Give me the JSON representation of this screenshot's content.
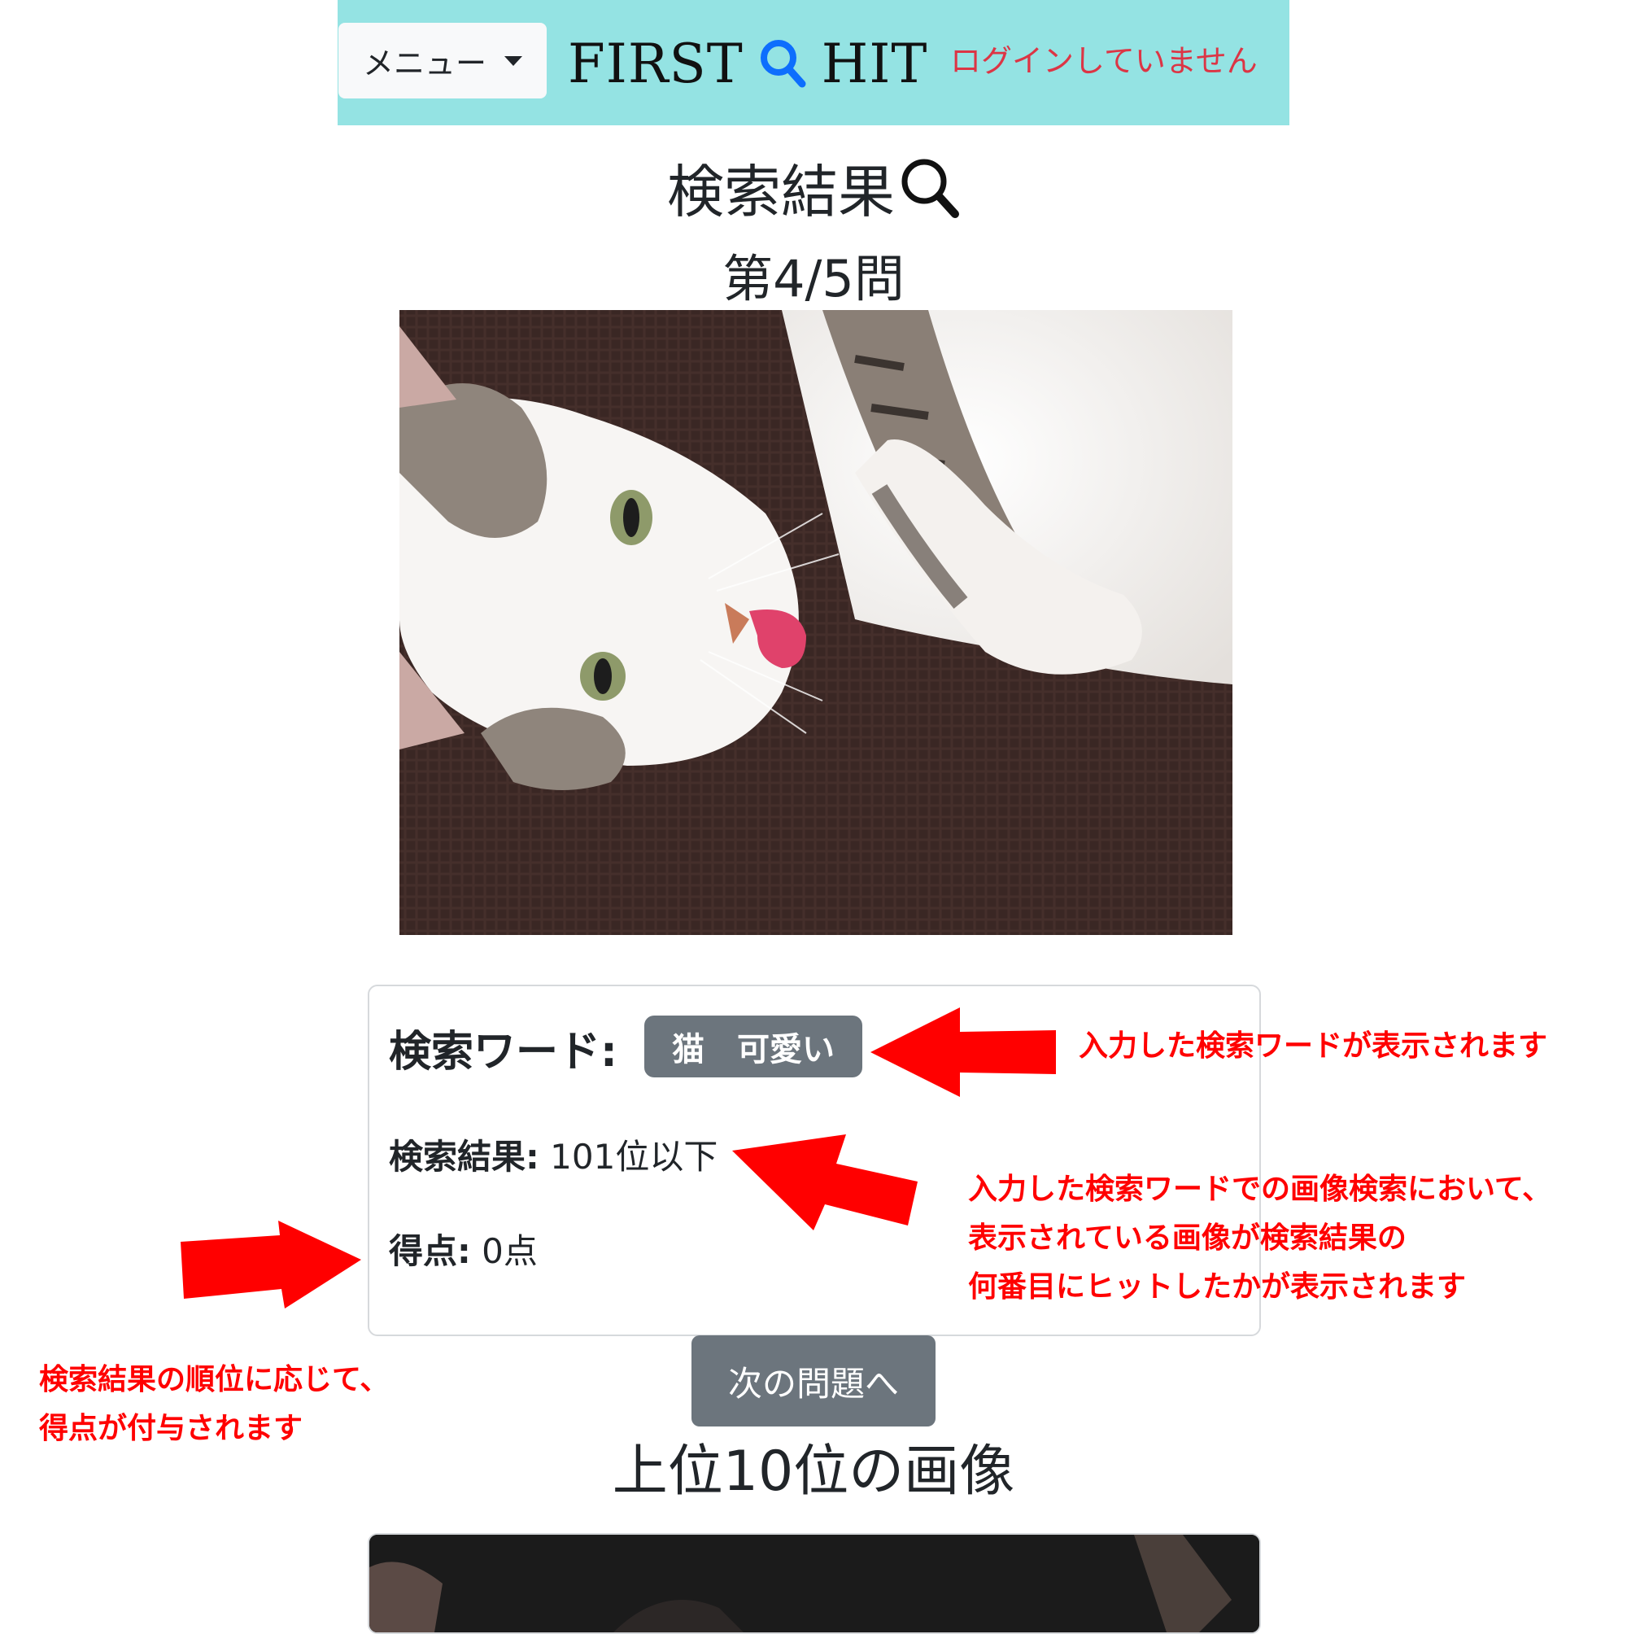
{
  "header": {
    "menu_label": "メニュー",
    "brand_left": "FIRST",
    "brand_right": "HIT",
    "login_status": "ログインしていません",
    "header_bg": "#94e3e3",
    "brand_icon_color": "#0d6efd",
    "login_color": "#dc3545"
  },
  "main": {
    "title": "検索結果",
    "question_counter": "第4/5問",
    "search_word_label": "検索ワード:",
    "search_word_value": "猫　可愛い",
    "result_label": "検索結果:",
    "result_value": " 101位以下",
    "score_label": "得点:",
    "score_value": " 0点",
    "next_button": "次の問題へ",
    "top10_title": "上位10位の画像"
  },
  "annotations": {
    "search_word": "入力した検索ワードが表示されます",
    "result_line1": "入力した検索ワードでの画像検索において、",
    "result_line2": "表示されている画像が検索結果の",
    "result_line3": "何番目にヒットしたかが表示されます",
    "score_line1": "検索結果の順位に応じて、",
    "score_line2": "得点が付与されます",
    "color": "#ff0000"
  }
}
